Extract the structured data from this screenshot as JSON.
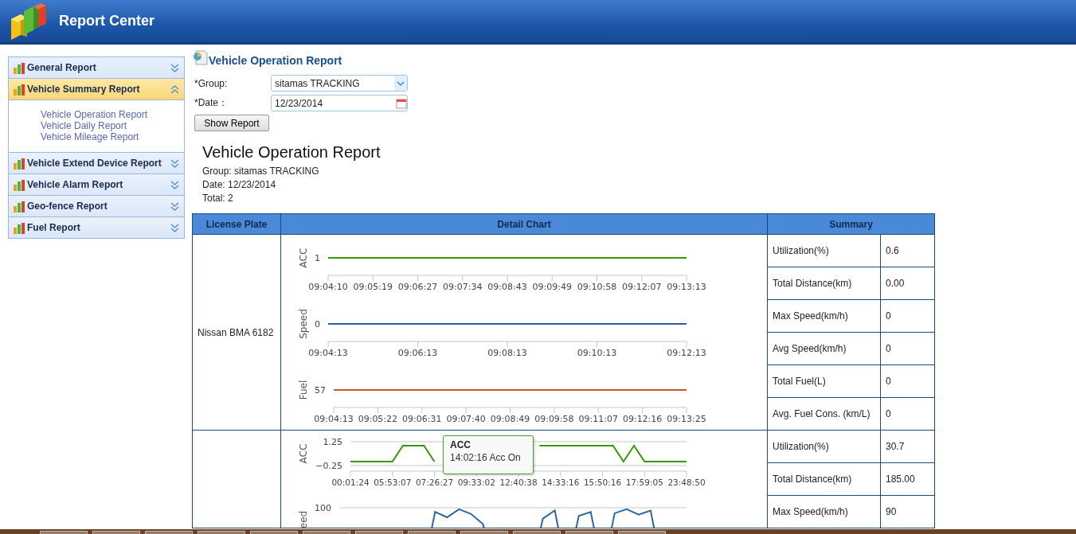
{
  "header": {
    "title": "Report Center"
  },
  "sidebar": {
    "items": [
      {
        "label": "General Report",
        "expanded": false
      },
      {
        "label": "Vehicle Summary Report",
        "expanded": true,
        "children": [
          {
            "label": "Vehicle Operation Report"
          },
          {
            "label": "Vehicle Daily Report"
          },
          {
            "label": "Vehicle Mileage Report"
          }
        ]
      },
      {
        "label": "Vehicle Extend Device Report",
        "expanded": false
      },
      {
        "label": "Vehicle Alarm Report",
        "expanded": false
      },
      {
        "label": "Geo-fence Report",
        "expanded": false
      },
      {
        "label": "Fuel Report",
        "expanded": false
      }
    ]
  },
  "form": {
    "title": "Vehicle Operation Report",
    "fields": [
      {
        "kind": "select",
        "label": "*Group:",
        "value": "sitamas TRACKING"
      },
      {
        "kind": "date",
        "label": "*Date：",
        "value": "12/23/2014"
      }
    ],
    "button": "Show Report"
  },
  "report": {
    "title": "Vehicle Operation Report",
    "lines": [
      "Group: sitamas TRACKING",
      "Date: 12/23/2014",
      "Total: 2"
    ]
  },
  "table": {
    "columns": [
      "License Plate",
      "Detail Chart",
      "Summary"
    ],
    "rows": [
      {
        "plate": "Nissan BMA 6182",
        "charts": [
          {
            "kind": "flat_trace",
            "ylabel": "ACC",
            "value_label": "1",
            "color": "#339900",
            "time_labels": [
              "09:04:10",
              "09:05:19",
              "09:06:27",
              "09:07:34",
              "09:08:43",
              "09:09:49",
              "09:10:58",
              "09:12:07",
              "09:13:13"
            ]
          },
          {
            "kind": "flat_trace",
            "ylabel": "Speed",
            "value_label": "0",
            "color": "#2f5f9a",
            "time_labels": [
              "09:04:13",
              "09:06:13",
              "09:08:13",
              "09:10:13",
              "09:12:13"
            ]
          },
          {
            "kind": "flat_trace",
            "ylabel": "Fuel",
            "value_label": "57",
            "color": "#cc5522",
            "time_labels": [
              "09:04:13",
              "09:05:22",
              "09:06:31",
              "09:07:40",
              "09:08:49",
              "09:09:58",
              "09:11:07",
              "09:12:16",
              "09:13:25"
            ]
          }
        ],
        "summary": [
          [
            "Utilization(%)",
            "0.6"
          ],
          [
            "Total Distance(km)",
            "0.00"
          ],
          [
            "Max Speed(km/h)",
            "0"
          ],
          [
            "Avg Speed(km/h)",
            "0"
          ],
          [
            "Total Fuel(L)",
            "0"
          ],
          [
            "Avg. Fuel Cons. (km/L)",
            "0"
          ]
        ]
      },
      {
        "plate": "",
        "tooltip": {
          "title": "ACC",
          "text": "14:02:16 Acc On"
        },
        "charts": [
          {
            "kind": "chart",
            "chart_data": {
              "type": "line",
              "ylabel": "ACC",
              "ylim": [
                -0.25,
                1.25
              ],
              "yticks": [
                {
                  "value": 1.25,
                  "label": "1.25"
                },
                {
                  "value": -0.25,
                  "label": "−0.25"
                }
              ],
              "categories": [
                "00:01:24",
                null,
                null,
                null,
                "05:53:07",
                null,
                null,
                null,
                "07:26:27",
                null,
                null,
                null,
                "09:33:02",
                null,
                null,
                null,
                "12:40:38",
                null,
                null,
                null,
                "14:33:16",
                null,
                null,
                null,
                "15:50:16",
                null,
                null,
                null,
                "17:59:05",
                null,
                null,
                null,
                "23:48:50"
              ],
              "series": [
                {
                  "color": "#339900",
                  "values": [
                    0,
                    0,
                    0,
                    0,
                    0,
                    1,
                    1,
                    1,
                    0,
                    null,
                    null,
                    null,
                    null,
                    null,
                    null,
                    null,
                    null,
                    null,
                    1,
                    1,
                    1,
                    1,
                    1,
                    1,
                    1,
                    1,
                    0,
                    1,
                    0,
                    0,
                    0,
                    0,
                    0
                  ]
                }
              ]
            }
          },
          {
            "kind": "spike_trace",
            "ylabel": "eed",
            "value_label": "100",
            "color": "#336699"
          }
        ],
        "summary": [
          [
            "Utilization(%)",
            "30.7"
          ],
          [
            "Total Distance(km)",
            "185.00"
          ],
          [
            "Max Speed(km/h)",
            "90"
          ]
        ]
      }
    ]
  }
}
